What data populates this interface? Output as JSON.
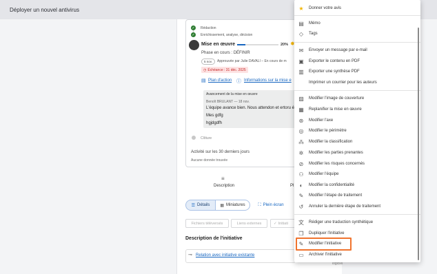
{
  "topbar": {
    "title": "Déployer un nouvel antivirus"
  },
  "workflow": {
    "steps": [
      {
        "label": "Rédaction"
      },
      {
        "label": "Enrichissement, analyse, décision"
      }
    ],
    "current": {
      "title": "Mise en œuvre",
      "progress_label": "20%",
      "progress": 0.2,
      "phase": "Phase en cours : DÉFINIR",
      "badge": "5 nov.",
      "approval": "Approuvée par Julie DAVALI – En cours de m",
      "deadline": "Échéance : 31 déc. 2025",
      "plan_link": "Plan d'action",
      "info_link": "Informations sur la mise e"
    },
    "comment": {
      "header": "Avancement de la mise en œuvre",
      "author": "Benoît BRULANT — 18 nov.",
      "lines": [
        "L'équipe avance bien. Nous attendon et ertoru é",
        "Mes gdfg",
        "hgjdgdfh"
      ]
    },
    "closure": "Clôture",
    "activity": "Activité sur les 30 derniers jours",
    "no_data": "Aucune donnée trouvée"
  },
  "main": {
    "description_tab": "Description",
    "plan_tab_partial": "Pl",
    "view_details": "Détails",
    "view_thumbnails": "Miniatures",
    "fullscreen": "Plein écran",
    "chips": [
      "Fichiers téléversés",
      "Liens externes",
      "Initiati"
    ],
    "description_heading": "Description de l'initiative",
    "relation_link": "Relation avec initiative existante",
    "partial_text": "logiciel"
  },
  "menu": {
    "items": [
      {
        "label": "Donner votre avis",
        "icon": "star-icon"
      },
      {
        "label": "Mémo",
        "icon": "memo-icon"
      },
      {
        "label": "Tags",
        "icon": "tag-icon"
      },
      {
        "label": "Envoyer un message par e-mail",
        "icon": "mail-icon"
      },
      {
        "label": "Exporter le contenu en PDF",
        "icon": "pdf-icon"
      },
      {
        "label": "Exporter une synthèse PDF",
        "icon": "summary-icon"
      },
      {
        "label": "Imprimer un courrier pour les auteurs",
        "icon": ""
      },
      {
        "label": "Modifier l'image de couverture",
        "icon": "image-icon"
      },
      {
        "label": "Replanifier la mise en œuvre",
        "icon": "calendar-icon"
      },
      {
        "label": "Modifier l'axe",
        "icon": "axis-icon"
      },
      {
        "label": "Modifier le périmètre",
        "icon": "target-icon"
      },
      {
        "label": "Modifier la classification",
        "icon": "shapes-icon"
      },
      {
        "label": "Modifier les parties prenantes",
        "icon": "stakeholders-icon"
      },
      {
        "label": "Modifier les risques concernés",
        "icon": "risk-icon"
      },
      {
        "label": "Modifier l'équipe",
        "icon": "team-icon"
      },
      {
        "label": "Modifier la confidentialité",
        "icon": "privacy-icon"
      },
      {
        "label": "Modifier l'étape de traitement",
        "icon": "pencil-icon"
      },
      {
        "label": "Annuler la dernière étape de traitement",
        "icon": "undo-icon"
      },
      {
        "label": "Rédiger une traduction synthétique",
        "icon": "translate-icon"
      },
      {
        "label": "Dupliquer l'initiative",
        "icon": "copy-icon"
      },
      {
        "label": "Modifier l'initiative",
        "icon": "edit-icon"
      },
      {
        "label": "Archiver l'initiative",
        "icon": "archive-icon"
      }
    ]
  },
  "colors": {
    "accent": "#1565c0",
    "highlight": "#f0732d",
    "success": "#2e7d32",
    "deadline_bg": "#fde3e3",
    "deadline_text": "#c62828"
  }
}
